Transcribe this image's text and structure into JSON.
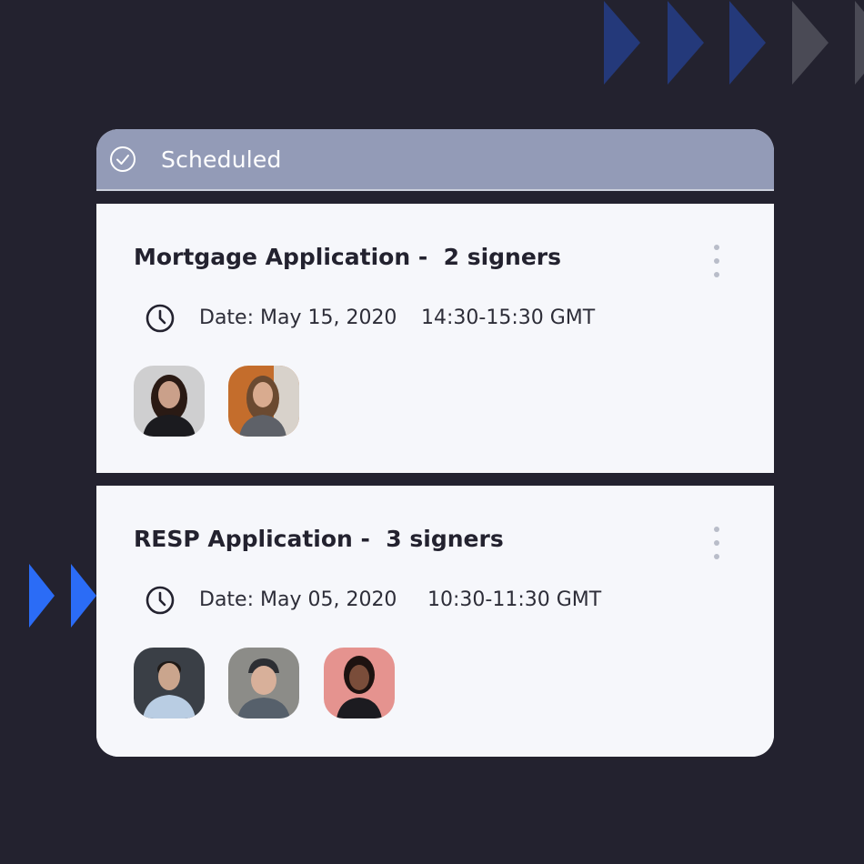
{
  "status": {
    "label": "Scheduled",
    "icon": "check-circle-icon"
  },
  "appointments": [
    {
      "title": "Mortgage Application -  2 signers",
      "date": "Date: May 15, 2020",
      "time": "14:30-15:30 GMT",
      "signers": [
        {
          "name": "signer-avatar-1",
          "bg": "#cfcfd0",
          "hair": "#2a1a14",
          "skin": "#caa08a",
          "shirt": "#1b1b1f"
        },
        {
          "name": "signer-avatar-2",
          "bg": "#c46d2c",
          "hair": "#6b4a31",
          "skin": "#d9ab8f",
          "shirt": "#5e6168"
        }
      ]
    },
    {
      "title": "RESP Application -  3 signers",
      "date": "Date: May 05, 2020",
      "time": "10:30-11:30 GMT",
      "signers": [
        {
          "name": "signer-avatar-1",
          "bg": "#3a3f46",
          "hair": "#1f1a17",
          "skin": "#caa58d",
          "shirt": "#b9cde3"
        },
        {
          "name": "signer-avatar-2",
          "bg": "#8c8c88",
          "hair": "#2c2e33",
          "skin": "#d8b09a",
          "shirt": "#56606b"
        },
        {
          "name": "signer-avatar-3",
          "bg": "#e5938f",
          "hair": "#1d1210",
          "skin": "#7a4d3a",
          "shirt": "#1c1b20"
        }
      ]
    }
  ],
  "colors": {
    "background": "#23222f",
    "header": "#939bb7",
    "card": "#f6f7fb",
    "chevron_blue": "#2b6cf6",
    "chevron_navy": "#24397a",
    "chevron_gray": "#4a4a55"
  }
}
